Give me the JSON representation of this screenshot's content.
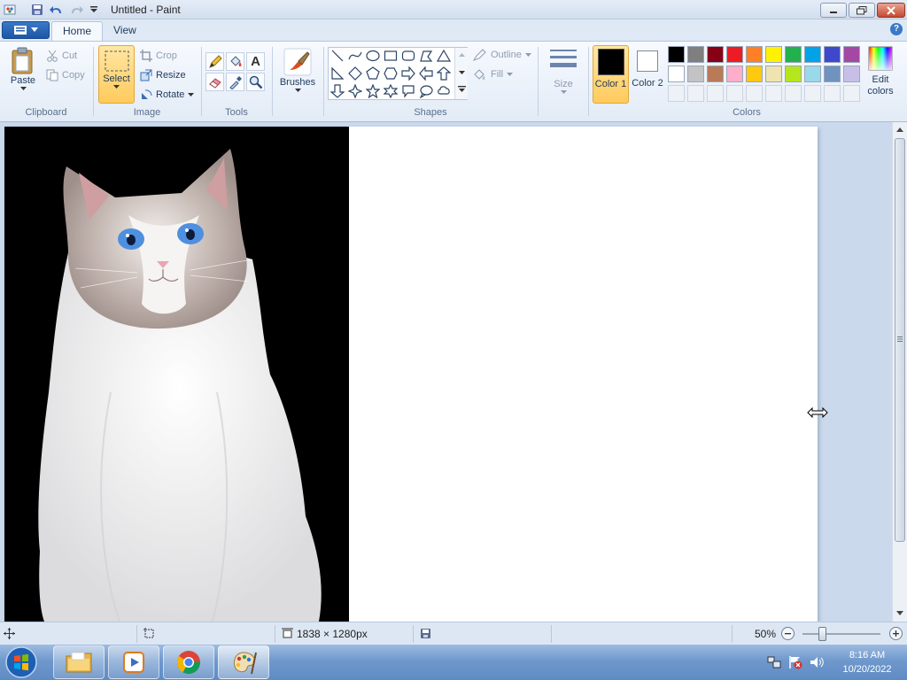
{
  "window": {
    "title": "Untitled - Paint"
  },
  "tabs": [
    {
      "label": "Home",
      "active": true
    },
    {
      "label": "View",
      "active": false
    }
  ],
  "clipboard": {
    "group": "Clipboard",
    "paste": "Paste",
    "cut": "Cut",
    "copy": "Copy"
  },
  "image": {
    "group": "Image",
    "select": "Select",
    "crop": "Crop",
    "resize": "Resize",
    "rotate": "Rotate"
  },
  "tools": {
    "group": "Tools",
    "text_icon": "A"
  },
  "brushes": {
    "label": "Brushes"
  },
  "shapes": {
    "group": "Shapes",
    "outline": "Outline",
    "fill": "Fill"
  },
  "size": {
    "label": "Size"
  },
  "colors": {
    "group": "Colors",
    "color1": "Color 1",
    "color2": "Color 2",
    "edit": "Edit colors",
    "color1_value": "#000000",
    "color2_value": "#ffffff",
    "palette_row1": [
      "#000000",
      "#7f7f7f",
      "#880015",
      "#ed1c24",
      "#ff7f27",
      "#fff200",
      "#22b14c",
      "#00a2e8",
      "#3f48cc",
      "#a349a4"
    ],
    "palette_row2": [
      "#ffffff",
      "#c3c3c3",
      "#b97a57",
      "#ffaec9",
      "#ffc90e",
      "#efe4b0",
      "#b5e61d",
      "#99d9ea",
      "#7092be",
      "#c8bfe7"
    ]
  },
  "status": {
    "dimensions": "1838 × 1280px",
    "zoom": "50%"
  },
  "taskbar": {
    "time": "8:16 AM",
    "date": "10/20/2022"
  }
}
